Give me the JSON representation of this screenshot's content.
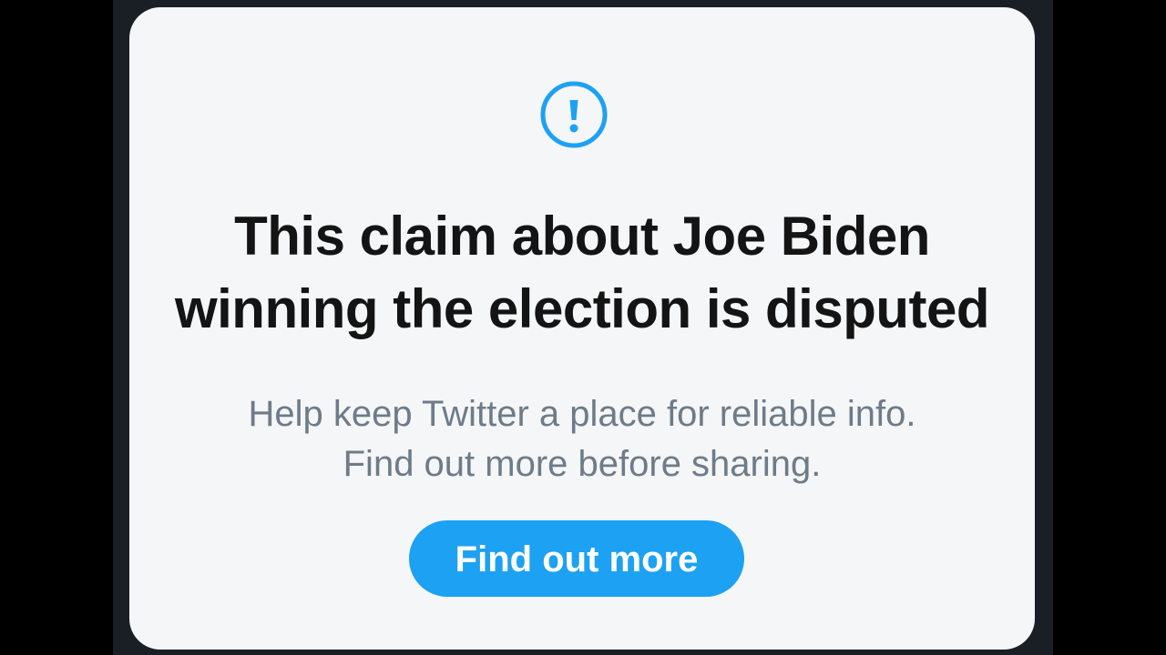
{
  "notice": {
    "icon": "exclamation-circle-icon",
    "headline_line1": "This claim about Joe Biden",
    "headline_line2": "winning the election is disputed",
    "subtext_line1": "Help keep Twitter a place for reliable info.",
    "subtext_line2": "Find out more before sharing.",
    "button_label": "Find out more"
  },
  "colors": {
    "accent": "#1da1f2",
    "card_background": "#f4f6f8",
    "headline_text": "#141414",
    "subtext": "#6e7b88"
  }
}
